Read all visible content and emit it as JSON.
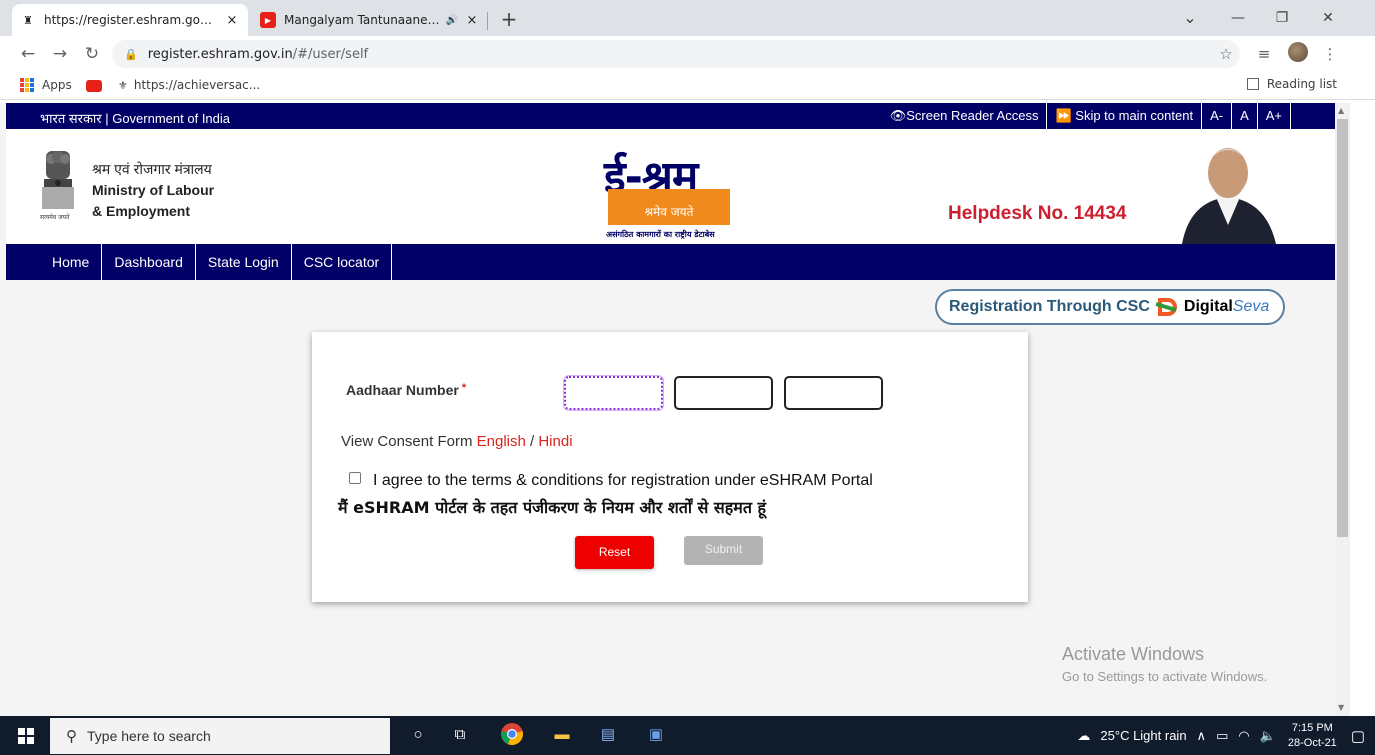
{
  "browser": {
    "tabs": [
      {
        "title": "https://register.eshram.gov.in/#/",
        "close": "×"
      },
      {
        "title": "Mangalyam Tantunaanena |",
        "close": "×",
        "audio": "🔊"
      }
    ],
    "new_tab": "+",
    "window_controls": {
      "minimize": "—",
      "restore": "❐",
      "close": "✕",
      "dropdown": "⌄"
    },
    "url_host": "register.eshram.gov.in",
    "url_path": "/#/user/self",
    "bookmarks": [
      {
        "label": "Apps"
      },
      {
        "label": ""
      },
      {
        "label": "https://achieversac..."
      }
    ],
    "reading_list": "Reading list"
  },
  "site": {
    "govbar_left": "भारत सरकार | Government of India",
    "govbar_right": [
      "👁Screen Reader Access",
      "⏩ Skip to main content",
      "A-",
      "A",
      "A+"
    ],
    "ministry_hi": "श्रम एवं रोजगार मंत्रालय",
    "ministry_en1": "Ministry of Labour",
    "ministry_en2": "& Employment",
    "emblem_motto": "सत्यमेव जयते",
    "logo_title": "ई-श्रम",
    "logo_tagline": "श्रमेव जयते",
    "logo_sub": "असंगठित कामगारों का राष्ट्रीय डेटाबेस",
    "helpdesk": "Helpdesk No. 14434",
    "menu": [
      "Home",
      "Dashboard",
      "State Login",
      "CSC locator"
    ],
    "csc_text": "Registration Through CSC",
    "csc_digital": "Digital",
    "csc_seva": "Seva"
  },
  "form": {
    "aadhaar_label": "Aadhaar Number",
    "required_mark": "*",
    "aadhaar_values": [
      "",
      "",
      ""
    ],
    "consent_prefix": "View Consent Form",
    "consent_english": "English",
    "consent_sep": "/",
    "consent_hindi": "Hindi",
    "agree_en": "I agree to the terms & conditions for registration under eSHRAM Portal",
    "agree_hi": "मैं eSHRAM पोर्टल के तहत पंजीकरण के नियम और शर्तों से सहमत हूं",
    "agree_checked": false,
    "reset_label": "Reset",
    "submit_label": "Submit"
  },
  "watermark": {
    "line1": "Activate Windows",
    "line2": "Go to Settings to activate Windows."
  },
  "taskbar": {
    "search_placeholder": "Type here to search",
    "weather": "25°C  Light rain",
    "time": "7:15 PM",
    "date": "28-Oct-21"
  }
}
